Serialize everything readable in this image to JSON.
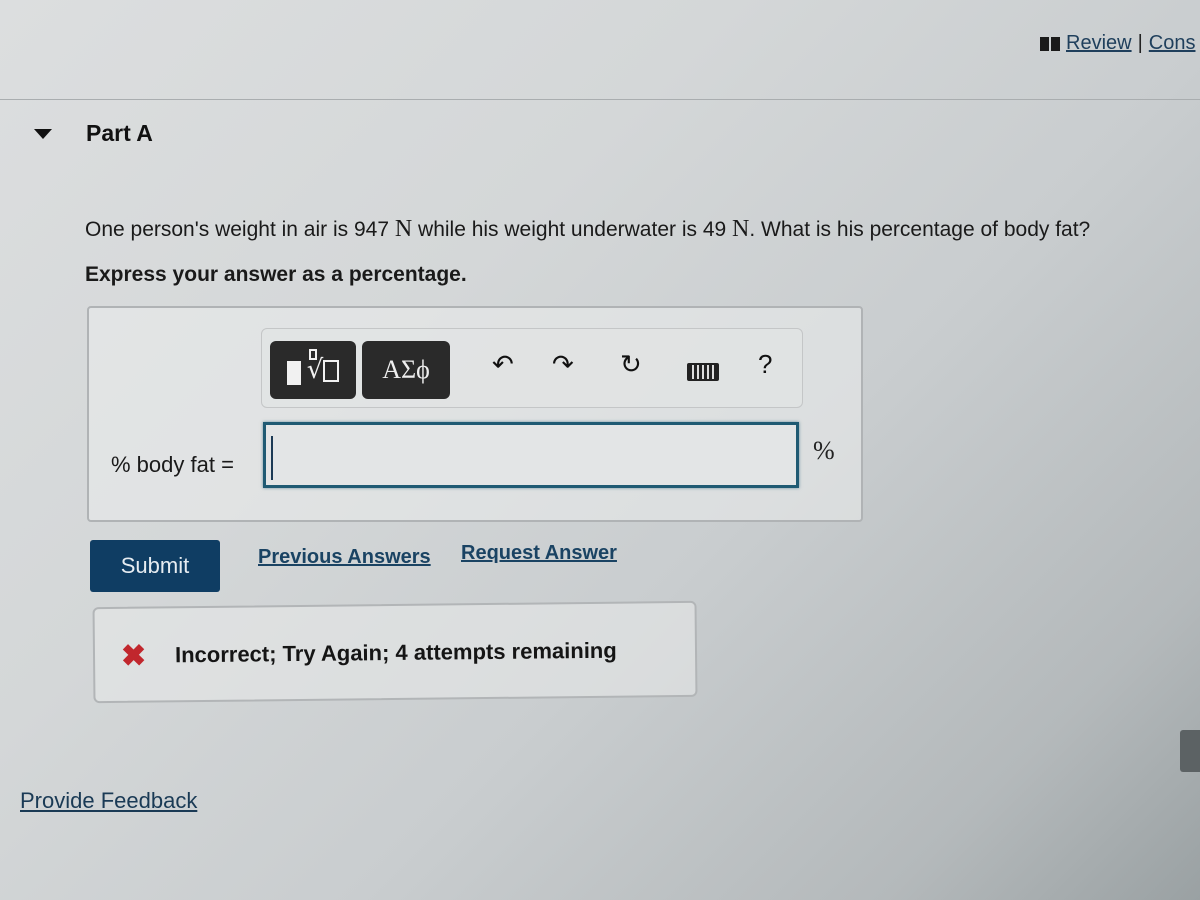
{
  "header": {
    "links": [
      "Review",
      "Cons"
    ],
    "separator": "|"
  },
  "part": {
    "title": "Part A",
    "expanded": true
  },
  "question": {
    "text_1": "One person's weight in air is 947 ",
    "unit_1": "N",
    "text_2": " while his weight underwater is 49 ",
    "unit_2": "N",
    "text_3": ". What is his percentage of body fat?",
    "instruction": "Express your answer as a percentage."
  },
  "toolbar": {
    "greek_label": "ΑΣϕ",
    "undo_glyph": "↶",
    "redo_glyph": "↷",
    "reset_glyph": "↻",
    "help_label": "?"
  },
  "answer": {
    "label": "% body fat =",
    "value": "",
    "unit": "%"
  },
  "actions": {
    "submit_label": "Submit",
    "previous_answers_label": "Previous Answers",
    "request_answer_label": "Request Answer"
  },
  "feedback": {
    "icon": "✖",
    "text": "Incorrect; Try Again; 4 attempts remaining",
    "status_color": "#c1272d"
  },
  "footer": {
    "provide_feedback_label": "Provide Feedback"
  }
}
